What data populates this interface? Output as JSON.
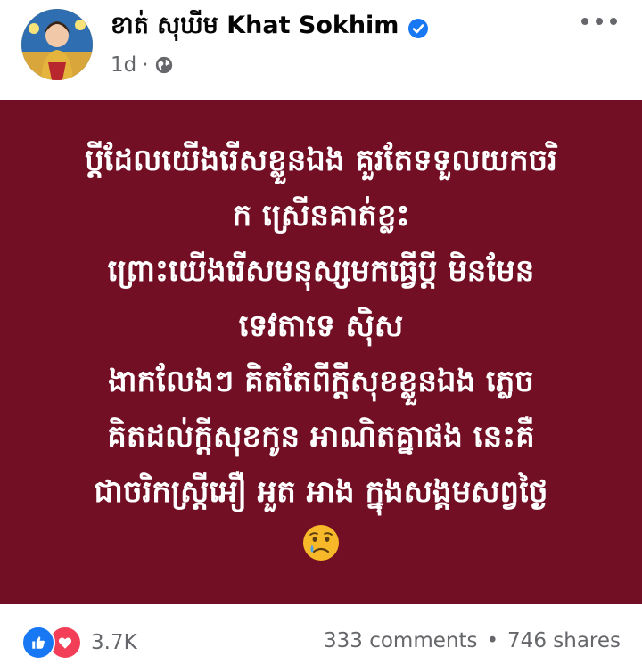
{
  "post": {
    "author": {
      "name": "ខាត់ សុឃីម Khat Sokhim",
      "verified_icon": "verified-badge-icon"
    },
    "time": "1d",
    "separator": "·",
    "audience_icon": "globe-icon",
    "more_icon": "more-options-icon",
    "content_lines": [
      "ប្តីដែលយើងរើសខ្លួនឯង គួរតែទទួលយកចរិ",
      "ក ស្រើនគាត់ខ្លះ",
      "ព្រោះយើងរើសមនុស្សមកធ្វើប្តី មិនមែន",
      "ទេវតាទេ ស៊ិស",
      "ងាកលែងៗ គិតតែពីក្តីសុខខ្លួនឯង ភ្លេច",
      "គិតដល់ក្តីសុខកូន អាណិតគ្នាផង នេះគឺ",
      "ជាចរិកស្រ្តីអឿ អួត អាង ក្នុងសង្គមសព្វថ្ងៃ"
    ],
    "emoji": "crying-face-emoji",
    "background_color": "#730f24"
  },
  "footer": {
    "reactions_count": "3.7K",
    "comments": "333 comments",
    "dot": "•",
    "shares": "746 shares"
  },
  "colors": {
    "accent_blue": "#1877f2",
    "love_red": "#f33e58",
    "muted_text": "#65676b"
  }
}
